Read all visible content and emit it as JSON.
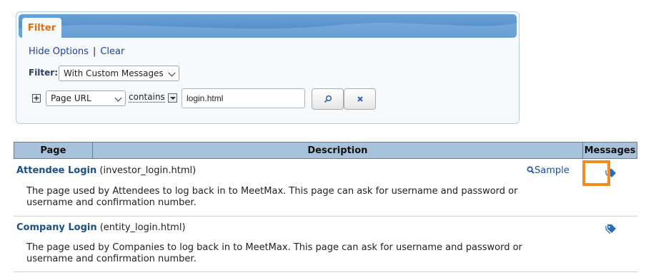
{
  "filter_panel": {
    "tab_label": "Filter",
    "hide_options": "Hide Options",
    "separator": "|",
    "clear": "Clear",
    "filter_label": "Filter:",
    "filter_select": "With Custom Messages",
    "field_select": "Page URL",
    "operator_label": "contains",
    "search_value": "login.html",
    "colors": {
      "tab_text": "#e36c0a",
      "header": "#4a86c4"
    }
  },
  "table": {
    "headers": [
      "Page",
      "Description",
      "Messages"
    ],
    "rows": [
      {
        "title": "Attendee Login",
        "file": "(investor_login.html)",
        "sample": "Sample",
        "description": "The page used by Attendees to log back in to MeetMax. This page can ask for username and password or username and confirmation number."
      },
      {
        "title": "Company Login",
        "file": "(entity_login.html)",
        "sample": "",
        "description": "The page used by Companies to log back in to MeetMax. This page can ask for username and password or username and confirmation number."
      }
    ],
    "icons": {
      "messages": "tags-icon",
      "sample": "magnifier-icon"
    },
    "highlight_color": "#f28c1e"
  }
}
